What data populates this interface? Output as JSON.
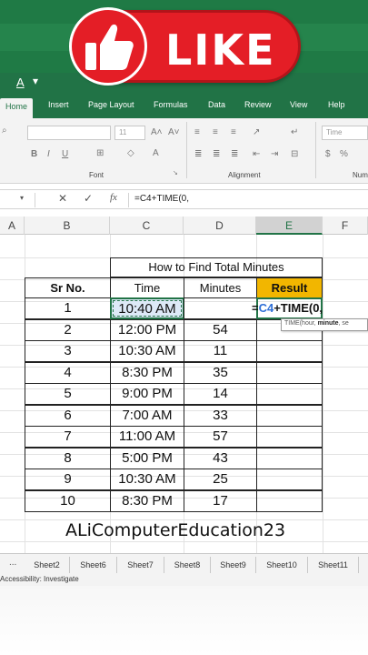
{
  "overlay": {
    "badge_text": "LIKE",
    "watermark": "ALiComputerEducation23"
  },
  "qat": {
    "font_color_letter": "A"
  },
  "ribbon": {
    "tabs": [
      "Home",
      "Insert",
      "Page Layout",
      "Formulas",
      "Data",
      "Review",
      "View",
      "Help"
    ],
    "active_tab": "Home",
    "font_size": "11",
    "number_format": "Time",
    "group_labels": {
      "font": "Font",
      "alignment": "Alignment",
      "number": "Num"
    }
  },
  "formula_bar": {
    "formula": "=C4+TIME(0,",
    "fx": "fx"
  },
  "columns": [
    "A",
    "B",
    "C",
    "D",
    "E",
    "F"
  ],
  "selected_column": "E",
  "table": {
    "title": "How to Find Total Minutes",
    "headers": [
      "Sr No.",
      "Time",
      "Minutes",
      "Result"
    ],
    "rows": [
      {
        "sr": "1",
        "time": "10:40 AM",
        "minutes": ""
      },
      {
        "sr": "2",
        "time": "12:00 PM",
        "minutes": "54"
      },
      {
        "sr": "3",
        "time": "10:30 AM",
        "minutes": "11"
      },
      {
        "sr": "4",
        "time": "8:30 PM",
        "minutes": "35"
      },
      {
        "sr": "5",
        "time": "9:00 PM",
        "minutes": "14"
      },
      {
        "sr": "6",
        "time": "7:00 AM",
        "minutes": "33"
      },
      {
        "sr": "7",
        "time": "11:00 AM",
        "minutes": "57"
      },
      {
        "sr": "8",
        "time": "5:00 PM",
        "minutes": "43"
      },
      {
        "sr": "9",
        "time": "10:30 AM",
        "minutes": "25"
      },
      {
        "sr": "10",
        "time": "8:30 PM",
        "minutes": "17"
      }
    ]
  },
  "editing_cell": {
    "prefix": "=",
    "ref": "C4",
    "suffix": "+TIME(0,"
  },
  "tooltip": {
    "fn": "TIME(hour, ",
    "bold": "minute",
    "rest": ", se"
  },
  "sheet_tabs": [
    "...",
    "Sheet2",
    "Sheet6",
    "Sheet7",
    "Sheet8",
    "Sheet9",
    "Sheet10",
    "Sheet11"
  ],
  "status": {
    "accessibility": "Accessibility: Investigate"
  },
  "colors": {
    "excel_green": "#217346",
    "result_header": "#f2b600",
    "like_red": "#e41e26"
  }
}
